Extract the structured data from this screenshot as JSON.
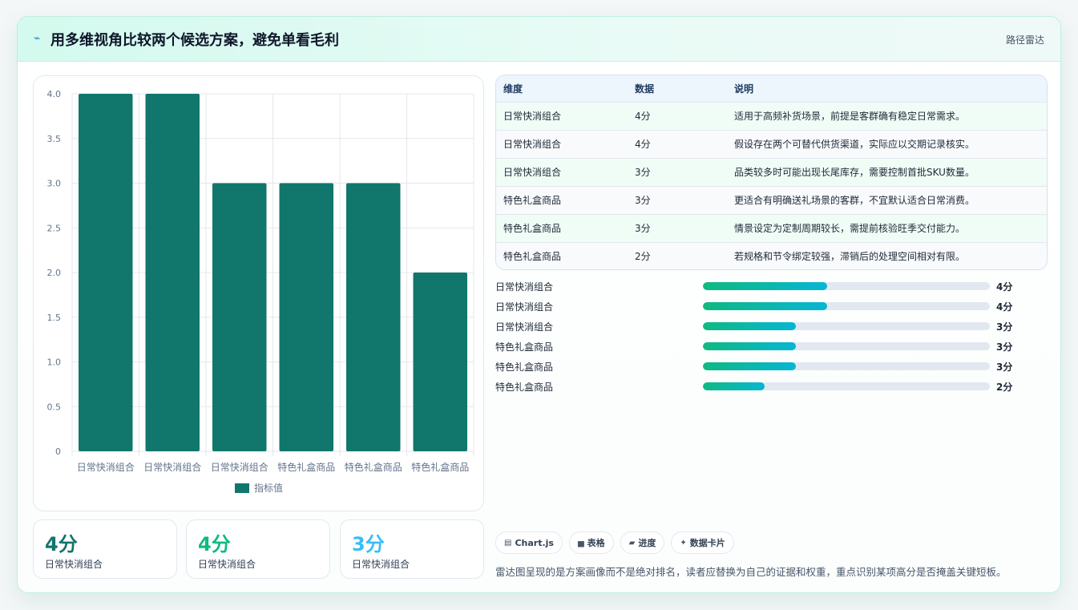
{
  "header": {
    "icon": "lightning-bolt-icon",
    "title": "用多维视角比较两个候选方案，避免单看毛利",
    "tag": "路径雷达"
  },
  "chart_data": {
    "type": "bar",
    "categories": [
      "日常快消组合",
      "日常快消组合",
      "日常快消组合",
      "特色礼盒商品",
      "特色礼盒商品",
      "特色礼盒商品"
    ],
    "series": [
      {
        "name": "指标值",
        "values": [
          4,
          4,
          3,
          3,
          3,
          2
        ]
      }
    ],
    "ylim": [
      0,
      4
    ],
    "yticks": [
      "0",
      "0.5",
      "1.0",
      "1.5",
      "2.0",
      "2.5",
      "3.0",
      "3.5",
      "4.0"
    ],
    "grid": true,
    "legend_position": "bottom",
    "color": "#11766c"
  },
  "stats": [
    {
      "value": "4分",
      "label": "日常快消组合",
      "color": "#11766c"
    },
    {
      "value": "4分",
      "label": "日常快消组合",
      "color": "#10b981"
    },
    {
      "value": "3分",
      "label": "日常快消组合",
      "color": "#38bdf8"
    }
  ],
  "table": {
    "headers": [
      "维度",
      "数据",
      "说明"
    ],
    "rows": [
      [
        "日常快消组合",
        "4分",
        "适用于高频补货场景，前提是客群确有稳定日常需求。"
      ],
      [
        "日常快消组合",
        "4分",
        "假设存在两个可替代供货渠道，实际应以交期记录核实。"
      ],
      [
        "日常快消组合",
        "3分",
        "品类较多时可能出现长尾库存，需要控制首批SKU数量。"
      ],
      [
        "特色礼盒商品",
        "3分",
        "更适合有明确送礼场景的客群，不宜默认适合日常消费。"
      ],
      [
        "特色礼盒商品",
        "3分",
        "情景设定为定制周期较长，需提前核验旺季交付能力。"
      ],
      [
        "特色礼盒商品",
        "2分",
        "若规格和节令绑定较强，滞销后的处理空间相对有限。"
      ]
    ]
  },
  "progress": [
    {
      "label": "日常快消组合",
      "value": "4分",
      "fraction": 0.432
    },
    {
      "label": "日常快消组合",
      "value": "4分",
      "fraction": 0.432
    },
    {
      "label": "日常快消组合",
      "value": "3分",
      "fraction": 0.324
    },
    {
      "label": "特色礼盒商品",
      "value": "3分",
      "fraction": 0.324
    },
    {
      "label": "特色礼盒商品",
      "value": "3分",
      "fraction": 0.324
    },
    {
      "label": "特色礼盒商品",
      "value": "2分",
      "fraction": 0.216
    }
  ],
  "chips": [
    {
      "icon": "chart-icon",
      "glyph": "▤",
      "label": "Chart.js"
    },
    {
      "icon": "table-icon",
      "glyph": "▅",
      "label": "表格"
    },
    {
      "icon": "progress-icon",
      "glyph": "▰",
      "label": "进度"
    },
    {
      "icon": "sparkle-icon",
      "glyph": "✦",
      "label": "数据卡片"
    }
  ],
  "note": "雷达图呈现的是方案画像而不是绝对排名，读者应替换为自己的证据和权重，重点识别某项高分是否掩盖关键短板。"
}
